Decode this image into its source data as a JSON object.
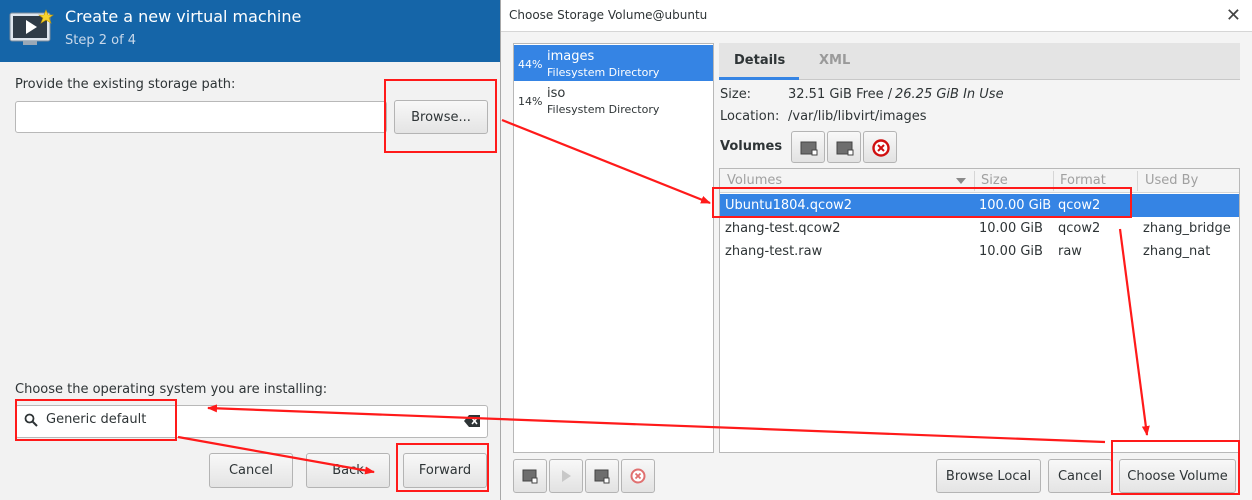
{
  "wizard": {
    "title": "Create a new virtual machine",
    "step": "Step 2 of 4",
    "storage_label": "Provide the existing storage path:",
    "storage_value": "",
    "browse_label": "Browse...",
    "os_label": "Choose the operating system you are installing:",
    "os_value": "Generic default",
    "cancel_label": "Cancel",
    "back_label": "Back",
    "forward_label": "Forward"
  },
  "dialog": {
    "title": "Choose Storage Volume@ubuntu",
    "pools": [
      {
        "percent": "44%",
        "name": "images",
        "type": "Filesystem Directory",
        "selected": true
      },
      {
        "percent": "14%",
        "name": "iso",
        "type": "Filesystem Directory",
        "selected": false
      }
    ],
    "tabs": {
      "details": "Details",
      "xml": "XML"
    },
    "size_label": "Size:",
    "size_free": "32.51 GiB Free /",
    "size_inuse": "26.25 GiB In Use",
    "location_label": "Location:",
    "location_value": "/var/lib/libvirt/images",
    "volumes_label": "Volumes",
    "columns": [
      "Volumes",
      "Size",
      "Format",
      "Used By"
    ],
    "rows": [
      {
        "name": "Ubuntu1804.qcow2",
        "size": "100.00 GiB",
        "format": "qcow2",
        "used_by": "",
        "selected": true
      },
      {
        "name": "zhang-test.qcow2",
        "size": "10.00 GiB",
        "format": "qcow2",
        "used_by": "zhang_bridge",
        "selected": false
      },
      {
        "name": "zhang-test.raw",
        "size": "10.00 GiB",
        "format": "raw",
        "used_by": "zhang_nat",
        "selected": false
      }
    ],
    "browse_local_label": "Browse Local",
    "cancel_label": "Cancel",
    "choose_label": "Choose Volume"
  },
  "colors": {
    "header_blue": "#1565a8",
    "selection_blue": "#3584e4",
    "annotation_red": "#ff1a1a"
  }
}
